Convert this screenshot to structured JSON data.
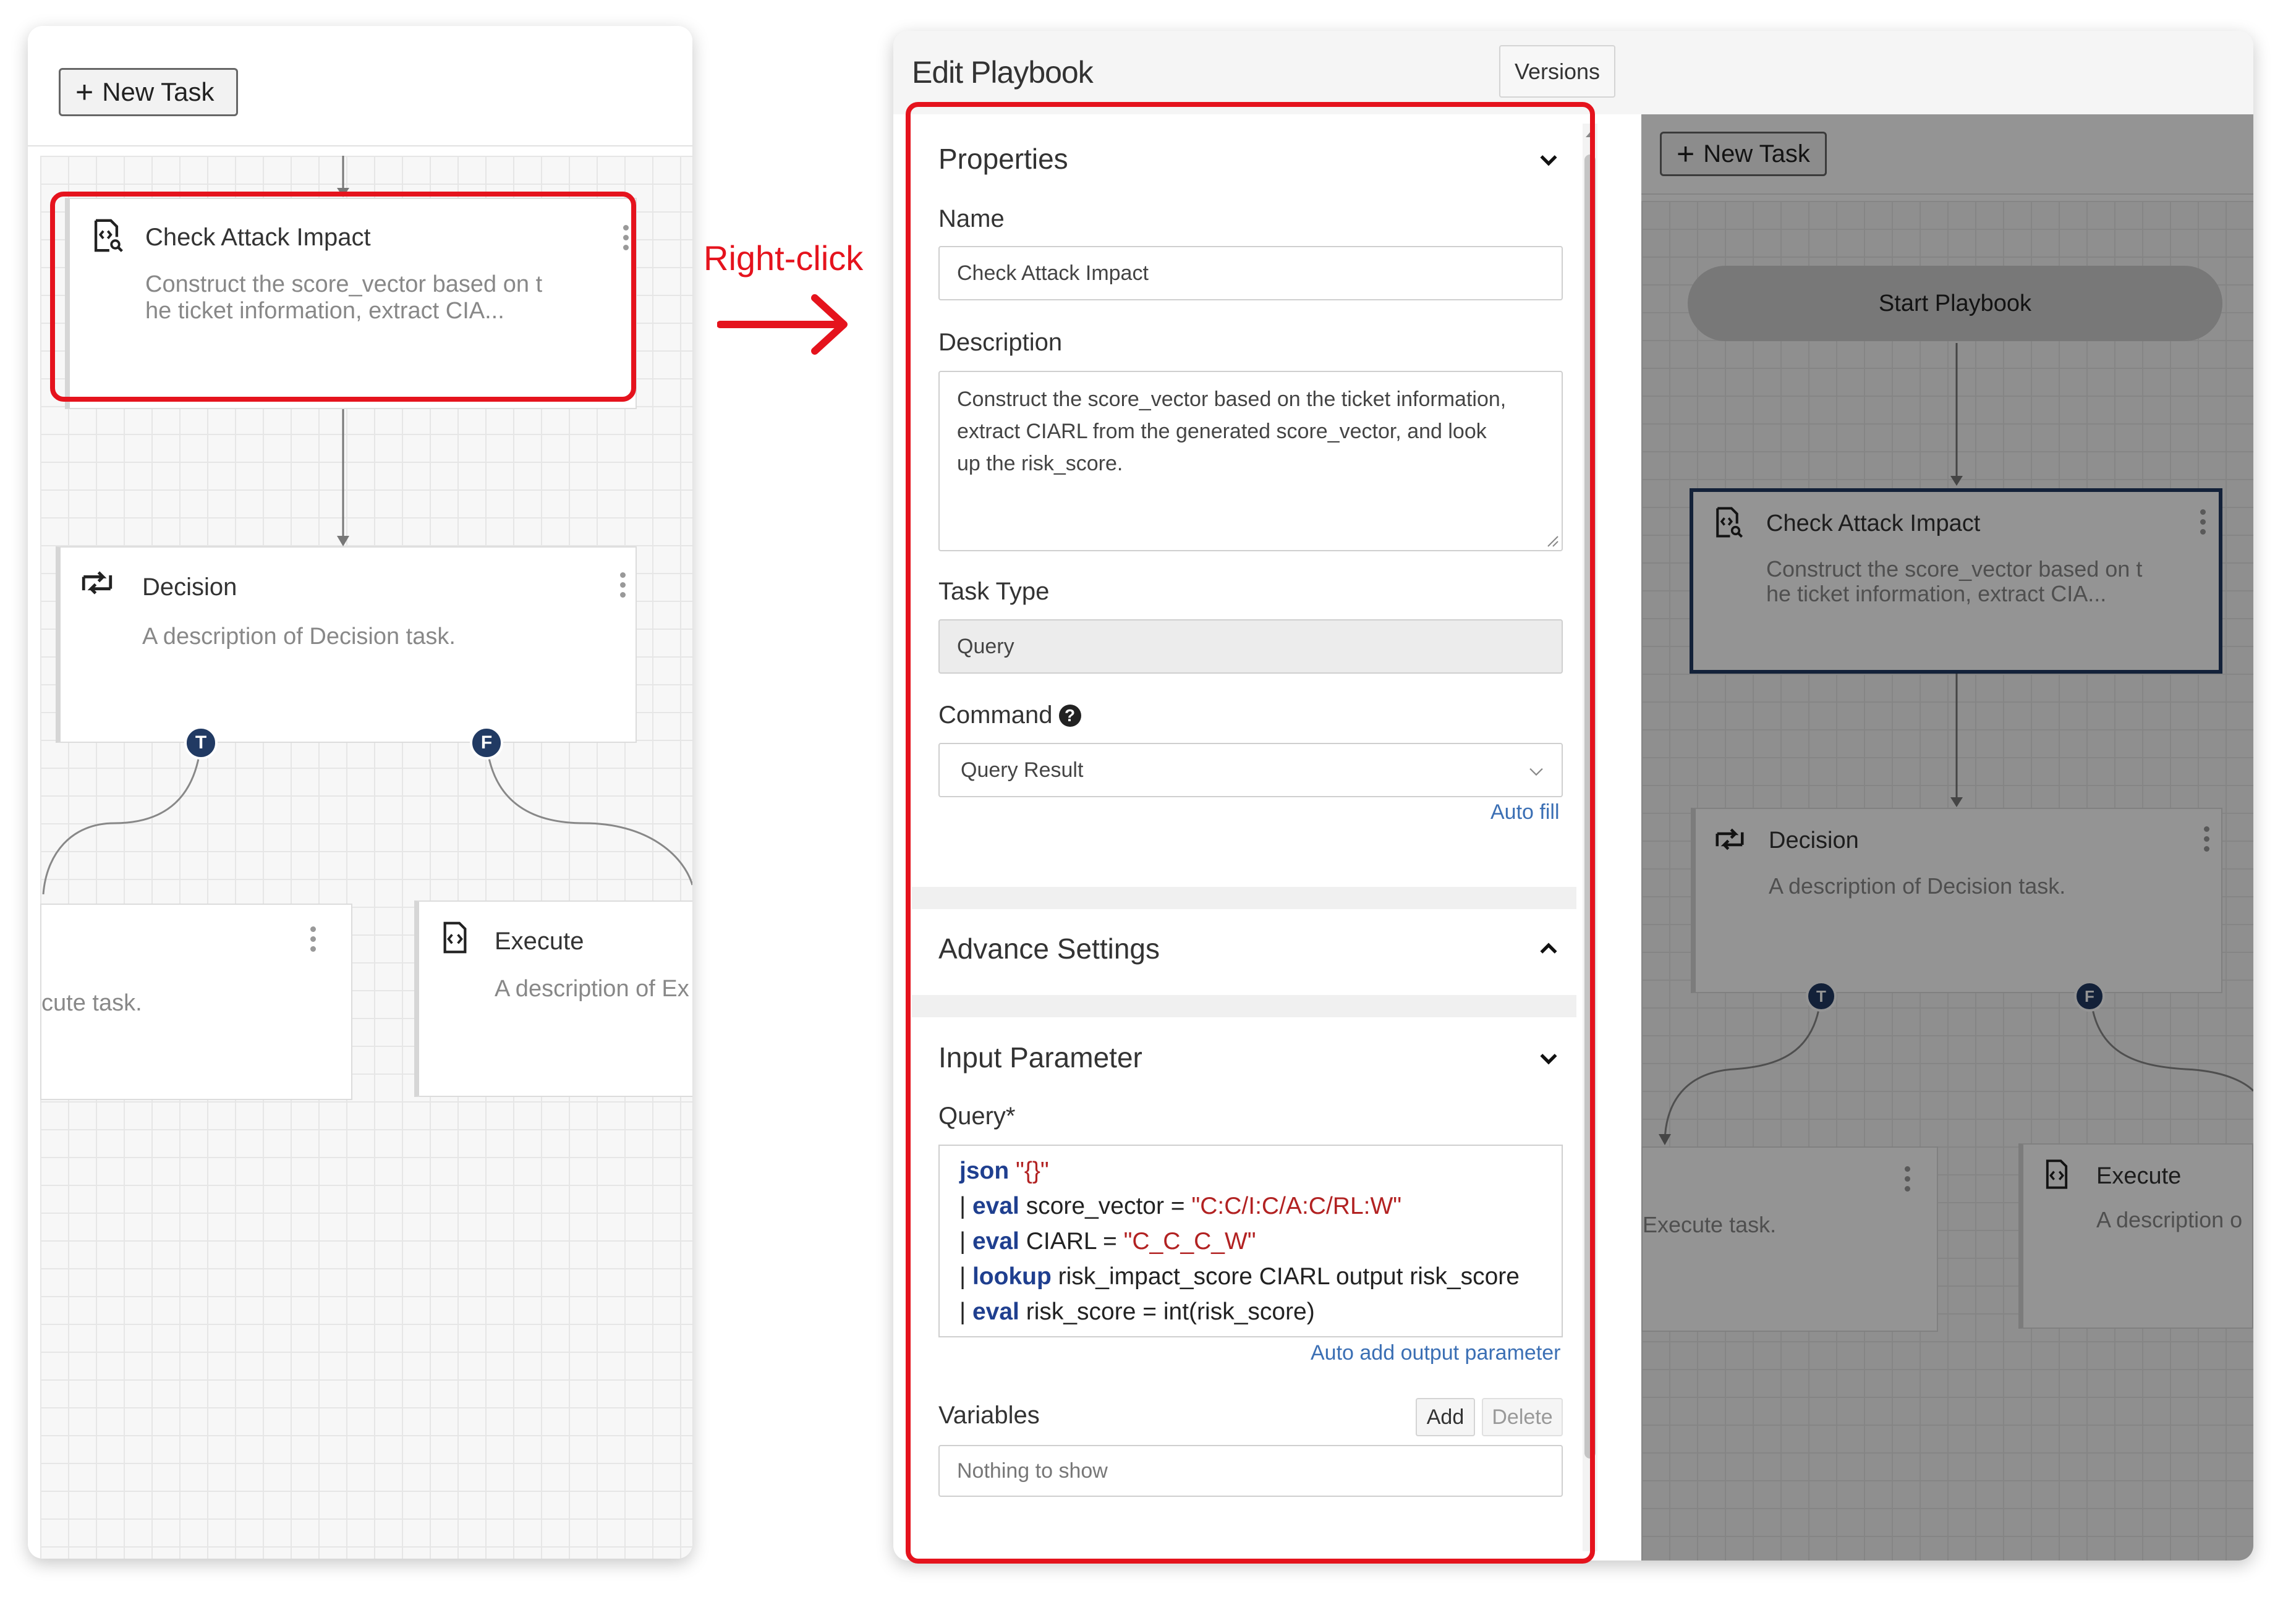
{
  "left_canvas": {
    "new_task_label": "New Task",
    "nodes": [
      {
        "title": "Check Attack Impact",
        "desc": "Construct the score_vector based on t\nhe ticket information, extract CIA..."
      },
      {
        "title": "Decision",
        "desc": "A description of Decision task."
      },
      {
        "title": "",
        "desc": "cute task."
      },
      {
        "title": "Execute",
        "desc": "A description of Ex"
      }
    ],
    "branch_true": "T",
    "branch_false": "F"
  },
  "annotation": {
    "label": "Right-click",
    "color": "#e5131d"
  },
  "edit_playbook": {
    "title": "Edit Playbook",
    "versions_label": "Versions",
    "properties": {
      "section_title": "Properties",
      "name_label": "Name",
      "name_value": "Check Attack Impact",
      "description_label": "Description",
      "description_value": "Construct the score_vector based on the ticket information, extract CIARL from the generated score_vector, and look up the risk_score.",
      "task_type_label": "Task Type",
      "task_type_value": "Query",
      "command_label": "Command",
      "command_value": "Query Result",
      "auto_fill_label": "Auto fill"
    },
    "advance_settings": {
      "section_title": "Advance Settings"
    },
    "input_parameter": {
      "section_title": "Input Parameter",
      "query_label": "Query*",
      "query_lines": [
        {
          "prefix": "",
          "kw": "json",
          "rest": " ",
          "str": "\"{}\"",
          "tail": ""
        },
        {
          "prefix": "| ",
          "kw": "eval",
          "rest": " score_vector = ",
          "str": "\"C:C/I:C/A:C/RL:W\"",
          "tail": ""
        },
        {
          "prefix": "| ",
          "kw": "eval",
          "rest": " CIARL = ",
          "str": "\"C_C_C_W\"",
          "tail": ""
        },
        {
          "prefix": "| ",
          "kw": "lookup",
          "rest": " risk_impact_score CIARL output risk_score",
          "str": "",
          "tail": ""
        },
        {
          "prefix": "| ",
          "kw": "eval",
          "rest": " risk_score = int(risk_score)",
          "str": "",
          "tail": ""
        }
      ],
      "auto_add_output_label": "Auto add output parameter",
      "variables_label": "Variables",
      "add_label": "Add",
      "delete_label": "Delete",
      "empty_label": "Nothing to show"
    }
  },
  "background_canvas": {
    "new_task_label": "New Task",
    "start_label": "Start Playbook",
    "nodes": [
      {
        "title": "Check Attack Impact",
        "desc": "Construct the score_vector based on t\nhe ticket information, extract CIA..."
      },
      {
        "title": "Decision",
        "desc": "A description of Decision task."
      },
      {
        "title": "",
        "desc": "Execute task."
      },
      {
        "title": "Execute",
        "desc": "A description o"
      }
    ],
    "branch_true": "T",
    "branch_false": "F"
  }
}
